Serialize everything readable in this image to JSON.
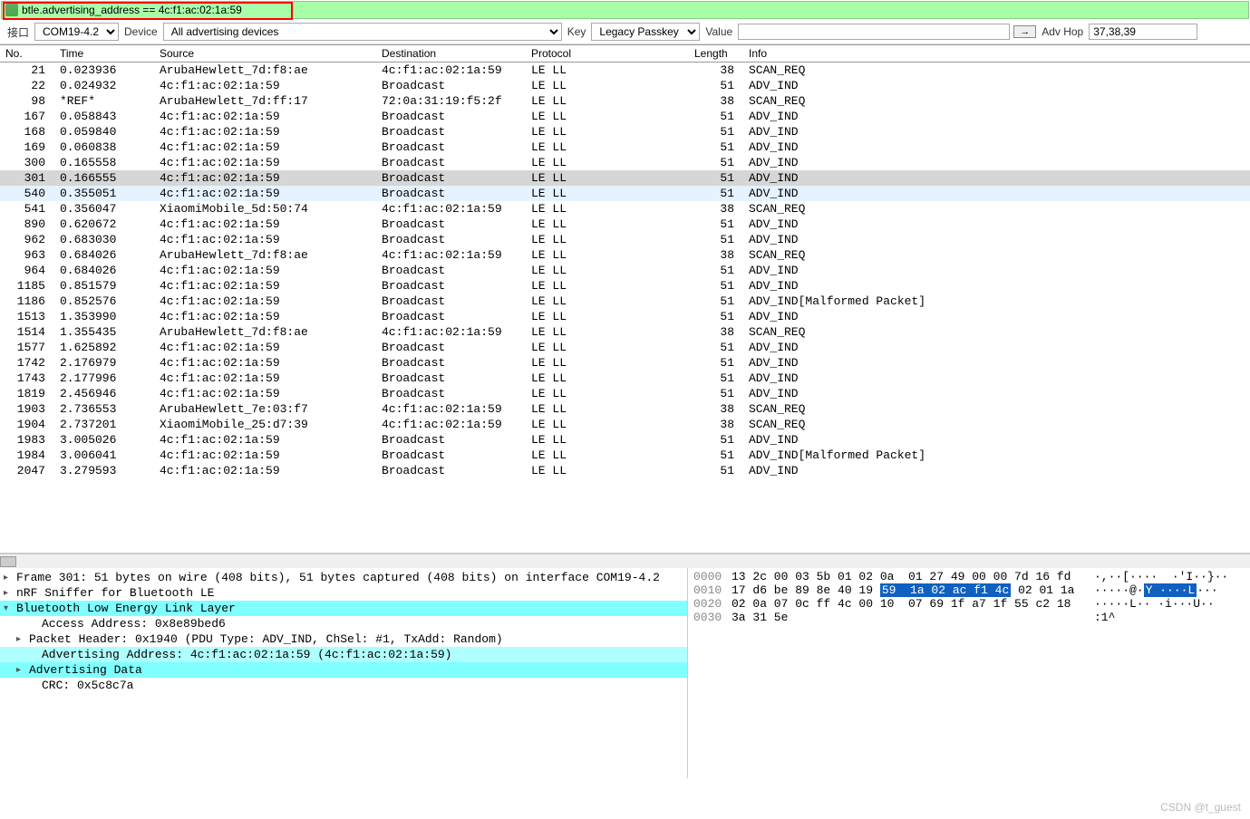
{
  "filter": {
    "text": "btle.advertising_address == 4c:f1:ac:02:1a:59"
  },
  "toolbar": {
    "interface_label": "接口",
    "com": "COM19-4.2",
    "device": "Device",
    "adv_devices": "All advertising devices",
    "key": "Key",
    "key_type": "Legacy Passkey",
    "value_label": "Value",
    "value": "",
    "arrow_btn": "→",
    "advhop_label": "Adv Hop",
    "advhop": "37,38,39"
  },
  "columns": [
    "No.",
    "Time",
    "Source",
    "Destination",
    "Protocol",
    "Length",
    "Info"
  ],
  "packets": [
    {
      "no": 21,
      "t": "0.023936",
      "src": "ArubaHewlett_7d:f8:ae",
      "dst": "4c:f1:ac:02:1a:59",
      "p": "LE LL",
      "len": 38,
      "info": "SCAN_REQ"
    },
    {
      "no": 22,
      "t": "0.024932",
      "src": "4c:f1:ac:02:1a:59",
      "dst": "Broadcast",
      "p": "LE LL",
      "len": 51,
      "info": "ADV_IND"
    },
    {
      "no": 98,
      "t": "*REF*",
      "src": "ArubaHewlett_7d:ff:17",
      "dst": "72:0a:31:19:f5:2f",
      "p": "LE LL",
      "len": 38,
      "info": "SCAN_REQ"
    },
    {
      "no": 167,
      "t": "0.058843",
      "src": "4c:f1:ac:02:1a:59",
      "dst": "Broadcast",
      "p": "LE LL",
      "len": 51,
      "info": "ADV_IND"
    },
    {
      "no": 168,
      "t": "0.059840",
      "src": "4c:f1:ac:02:1a:59",
      "dst": "Broadcast",
      "p": "LE LL",
      "len": 51,
      "info": "ADV_IND"
    },
    {
      "no": 169,
      "t": "0.060838",
      "src": "4c:f1:ac:02:1a:59",
      "dst": "Broadcast",
      "p": "LE LL",
      "len": 51,
      "info": "ADV_IND"
    },
    {
      "no": 300,
      "t": "0.165558",
      "src": "4c:f1:ac:02:1a:59",
      "dst": "Broadcast",
      "p": "LE LL",
      "len": 51,
      "info": "ADV_IND"
    },
    {
      "no": 301,
      "t": "0.166555",
      "src": "4c:f1:ac:02:1a:59",
      "dst": "Broadcast",
      "p": "LE LL",
      "len": 51,
      "info": "ADV_IND",
      "hl": 0
    },
    {
      "no": 540,
      "t": "0.355051",
      "src": "4c:f1:ac:02:1a:59",
      "dst": "Broadcast",
      "p": "LE LL",
      "len": 51,
      "info": "ADV_IND",
      "hl": 1
    },
    {
      "no": 541,
      "t": "0.356047",
      "src": "XiaomiMobile_5d:50:74",
      "dst": "4c:f1:ac:02:1a:59",
      "p": "LE LL",
      "len": 38,
      "info": "SCAN_REQ"
    },
    {
      "no": 890,
      "t": "0.620672",
      "src": "4c:f1:ac:02:1a:59",
      "dst": "Broadcast",
      "p": "LE LL",
      "len": 51,
      "info": "ADV_IND"
    },
    {
      "no": 962,
      "t": "0.683030",
      "src": "4c:f1:ac:02:1a:59",
      "dst": "Broadcast",
      "p": "LE LL",
      "len": 51,
      "info": "ADV_IND"
    },
    {
      "no": 963,
      "t": "0.684026",
      "src": "ArubaHewlett_7d:f8:ae",
      "dst": "4c:f1:ac:02:1a:59",
      "p": "LE LL",
      "len": 38,
      "info": "SCAN_REQ"
    },
    {
      "no": 964,
      "t": "0.684026",
      "src": "4c:f1:ac:02:1a:59",
      "dst": "Broadcast",
      "p": "LE LL",
      "len": 51,
      "info": "ADV_IND"
    },
    {
      "no": 1185,
      "t": "0.851579",
      "src": "4c:f1:ac:02:1a:59",
      "dst": "Broadcast",
      "p": "LE LL",
      "len": 51,
      "info": "ADV_IND"
    },
    {
      "no": 1186,
      "t": "0.852576",
      "src": "4c:f1:ac:02:1a:59",
      "dst": "Broadcast",
      "p": "LE LL",
      "len": 51,
      "info": "ADV_IND[Malformed Packet]"
    },
    {
      "no": 1513,
      "t": "1.353990",
      "src": "4c:f1:ac:02:1a:59",
      "dst": "Broadcast",
      "p": "LE LL",
      "len": 51,
      "info": "ADV_IND"
    },
    {
      "no": 1514,
      "t": "1.355435",
      "src": "ArubaHewlett_7d:f8:ae",
      "dst": "4c:f1:ac:02:1a:59",
      "p": "LE LL",
      "len": 38,
      "info": "SCAN_REQ"
    },
    {
      "no": 1577,
      "t": "1.625892",
      "src": "4c:f1:ac:02:1a:59",
      "dst": "Broadcast",
      "p": "LE LL",
      "len": 51,
      "info": "ADV_IND"
    },
    {
      "no": 1742,
      "t": "2.176979",
      "src": "4c:f1:ac:02:1a:59",
      "dst": "Broadcast",
      "p": "LE LL",
      "len": 51,
      "info": "ADV_IND"
    },
    {
      "no": 1743,
      "t": "2.177996",
      "src": "4c:f1:ac:02:1a:59",
      "dst": "Broadcast",
      "p": "LE LL",
      "len": 51,
      "info": "ADV_IND"
    },
    {
      "no": 1819,
      "t": "2.456946",
      "src": "4c:f1:ac:02:1a:59",
      "dst": "Broadcast",
      "p": "LE LL",
      "len": 51,
      "info": "ADV_IND"
    },
    {
      "no": 1903,
      "t": "2.736553",
      "src": "ArubaHewlett_7e:03:f7",
      "dst": "4c:f1:ac:02:1a:59",
      "p": "LE LL",
      "len": 38,
      "info": "SCAN_REQ"
    },
    {
      "no": 1904,
      "t": "2.737201",
      "src": "XiaomiMobile_25:d7:39",
      "dst": "4c:f1:ac:02:1a:59",
      "p": "LE LL",
      "len": 38,
      "info": "SCAN_REQ"
    },
    {
      "no": 1983,
      "t": "3.005026",
      "src": "4c:f1:ac:02:1a:59",
      "dst": "Broadcast",
      "p": "LE LL",
      "len": 51,
      "info": "ADV_IND"
    },
    {
      "no": 1984,
      "t": "3.006041",
      "src": "4c:f1:ac:02:1a:59",
      "dst": "Broadcast",
      "p": "LE LL",
      "len": 51,
      "info": "ADV_IND[Malformed Packet]"
    },
    {
      "no": 2047,
      "t": "3.279593",
      "src": "4c:f1:ac:02:1a:59",
      "dst": "Broadcast",
      "p": "LE LL",
      "len": 51,
      "info": "ADV_IND"
    }
  ],
  "tree": [
    {
      "arrow": ">",
      "sel": "",
      "text": "Frame 301: 51 bytes on wire (408 bits), 51 bytes captured (408 bits) on interface COM19-4.2"
    },
    {
      "arrow": ">",
      "sel": "",
      "text": "nRF Sniffer for Bluetooth LE"
    },
    {
      "arrow": "v",
      "sel": "sel",
      "text": "Bluetooth Low Energy Link Layer"
    },
    {
      "ind": 2,
      "sel": "",
      "text": "Access Address: 0x8e89bed6"
    },
    {
      "ind": 1,
      "arrow": ">",
      "sel": "",
      "text": "Packet Header: 0x1940 (PDU Type: ADV_IND, ChSel: #1, TxAdd: Random)"
    },
    {
      "ind": 2,
      "sel": "sel2",
      "text": "Advertising Address: 4c:f1:ac:02:1a:59 (4c:f1:ac:02:1a:59)"
    },
    {
      "ind": 1,
      "arrow": ">",
      "sel": "sel",
      "text": "Advertising Data"
    },
    {
      "ind": 2,
      "sel": "",
      "text": "CRC: 0x5c8c7a"
    }
  ],
  "hex": [
    {
      "off": "0000",
      "b": "13 2c 00 03 5b 01 02 0a  01 27 49 00 00 7d 16 fd",
      "a": "·,··[····  ·'I··}··"
    },
    {
      "off": "0010",
      "b_pre": "17 d6 be 89 8e 40 19 ",
      "b_hl": "59  1a 02 ac f1 4c",
      "b_post": " 02 01 1a",
      "a_pre": "·····@·",
      "a_hl": "Y ····L",
      "a_post": "···"
    },
    {
      "off": "0020",
      "b": "02 0a 07 0c ff 4c 00 10  07 69 1f a7 1f 55 c2 18",
      "a": "·····L·· ·i···U··"
    },
    {
      "off": "0030",
      "b": "3a 31 5e",
      "a": ":1^"
    }
  ],
  "watermark": "CSDN @t_guest"
}
